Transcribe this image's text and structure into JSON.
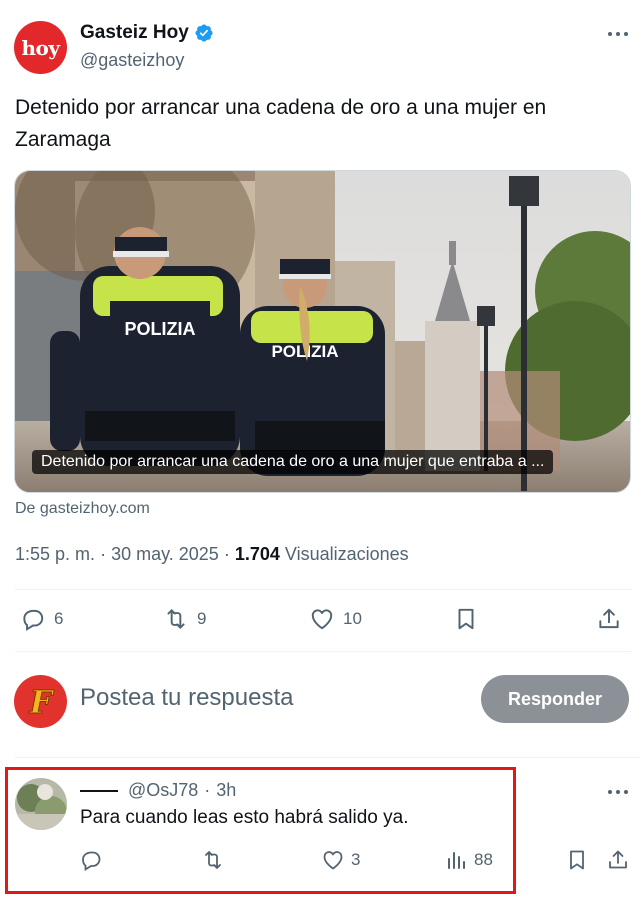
{
  "author": {
    "name": "Gasteiz Hoy",
    "handle": "@gasteizhoy",
    "avatar_text": "hoy",
    "verified": true
  },
  "tweet": {
    "text": "Detenido por arrancar una cadena de oro a una mujer en Zaramaga",
    "card_caption": "Detenido por arrancar una cadena de oro a una mujer que entraba a ...",
    "card_source": "De gasteizhoy.com",
    "image_labels": [
      "POLIZIA",
      "POLIZIA"
    ],
    "time": "1:55 p. m.",
    "date": "30 may. 2025",
    "views_count": "1.704",
    "views_label": "Visualizaciones"
  },
  "actions": {
    "replies": "6",
    "retweets": "9",
    "likes": "10"
  },
  "composer": {
    "placeholder": "Postea tu respuesta",
    "button_label": "Responder",
    "avatar_letter": "F"
  },
  "reply": {
    "handle": "@OsJ78",
    "time": "3h",
    "text": "Para cuando leas esto habrá salido ya.",
    "likes": "3",
    "views": "88"
  },
  "colors": {
    "brand_red": "#e2282b",
    "verified_blue": "#1d9bf0",
    "muted": "#536471",
    "button_gray": "#8b9196",
    "highlight": "#e01818"
  },
  "icons": [
    "verified-icon",
    "more-icon",
    "reply-icon",
    "retweet-icon",
    "like-icon",
    "bookmark-icon",
    "share-icon",
    "views-icon"
  ]
}
